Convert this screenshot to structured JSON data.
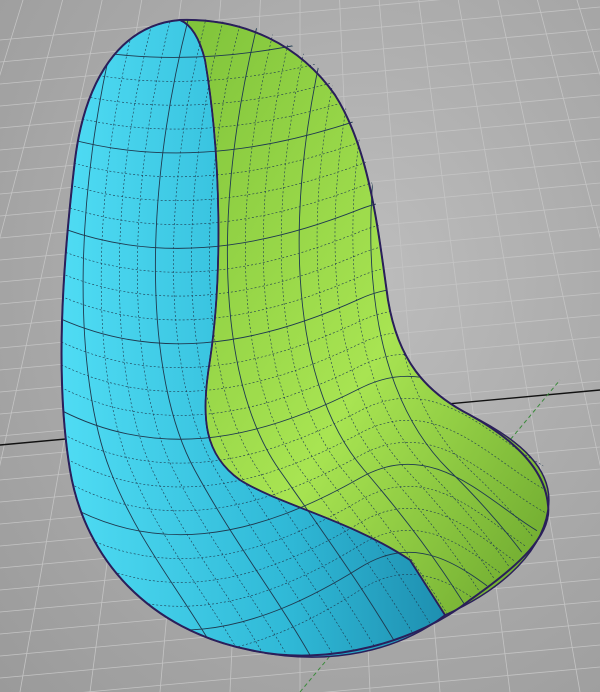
{
  "viewport": {
    "background": "#a9a9a9",
    "grid_color": "#c4c4c4",
    "axis_x_color": "#111111",
    "axis_y_color": "#3c8a3c"
  },
  "model": {
    "left_patch_color": "#2fb8d6",
    "right_patch_color": "#8fce3a",
    "isoparm_color": "#1f3a50",
    "outline_color": "#2a1f5a"
  }
}
